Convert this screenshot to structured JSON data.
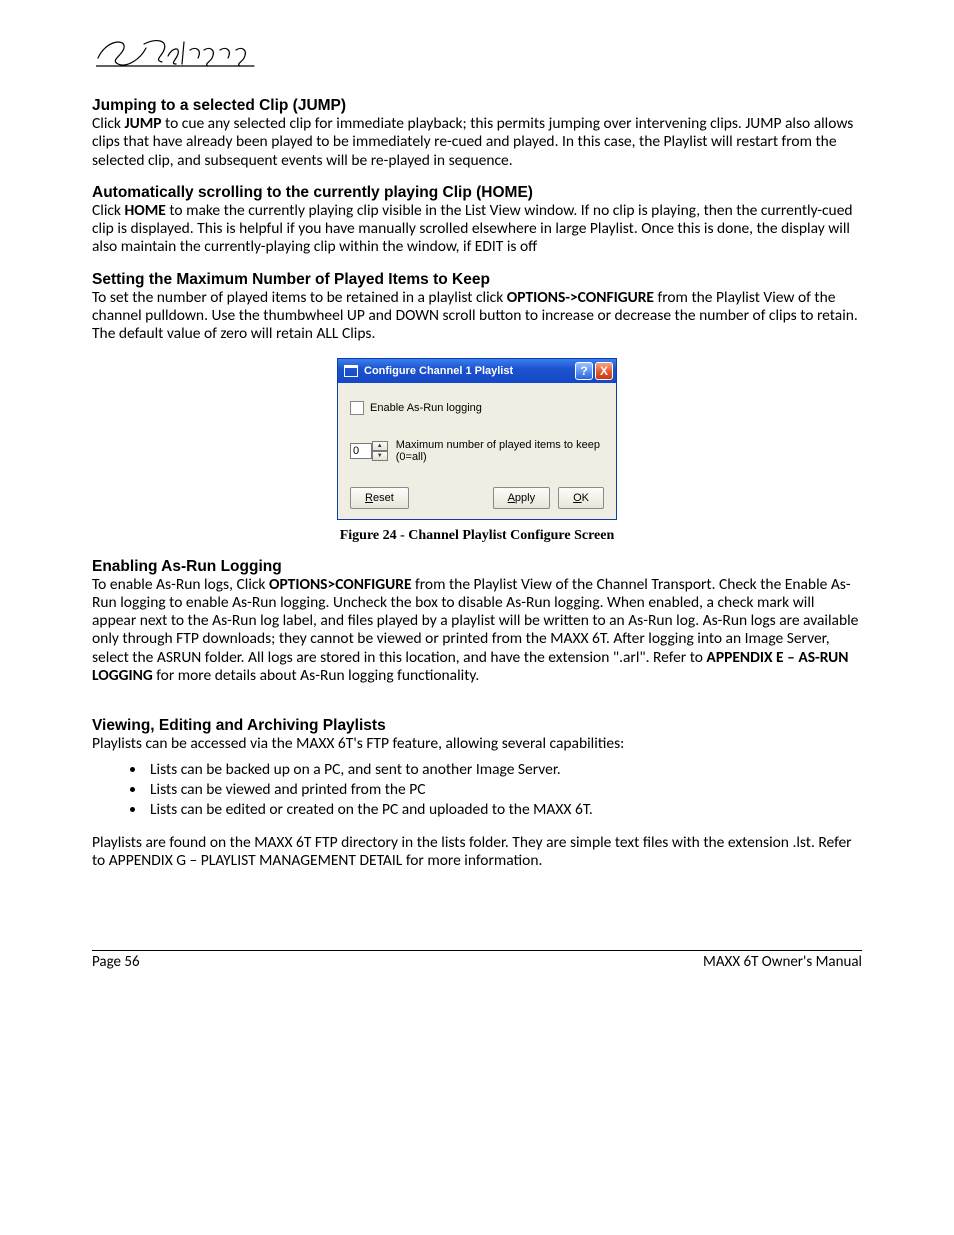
{
  "logo_alt": "360 Systems",
  "sections": {
    "jump": {
      "heading": "Jumping to a selected Clip (JUMP)",
      "p_lead": "Click ",
      "p_bold": "JUMP",
      "p_rest": " to cue any selected clip for immediate playback; this permits jumping over intervening clips.  JUMP also allows clips that have already been played to be immediately re-cued and played.  In this case, the Playlist will restart from the selected clip, and subsequent events will be re-played in sequence."
    },
    "home": {
      "heading": "Automatically scrolling to the currently playing Clip (HOME)",
      "p_lead": "Click ",
      "p_bold": "HOME",
      "p_rest": " to make the currently playing clip visible in the List View window.  If no clip is playing, then the currently-cued clip is displayed. This is helpful if you have manually scrolled elsewhere in large Playlist. Once this is done, the display will also maintain the currently-playing clip within the window, if EDIT is off"
    },
    "keep": {
      "heading": "Setting the Maximum Number of Played Items to Keep",
      "p_lead": "To set the number of played items to be retained in a playlist click ",
      "p_bold": "OPTIONS->CONFIGURE",
      "p_rest": " from the Playlist View of the channel pulldown. Use the thumbwheel UP and DOWN scroll button to increase or decrease the number of clips to retain. The default value of zero will retain ALL Clips."
    },
    "asrun": {
      "heading": "Enabling As-Run Logging",
      "p1_lead": "To enable As-Run logs, Click ",
      "p1_bold": "OPTIONS>CONFIGURE",
      "p1_rest": " from the Playlist View of the Channel Transport. Check the Enable As-Run logging to enable As-Run logging. Uncheck the box to disable As-Run logging.  When enabled, a check mark will appear next to the As-Run log label, and files played by a playlist will be written to an As-Run log. As-Run logs are available only through FTP downloads; they cannot be viewed or printed from the MAXX 6T.  After logging into an Image Server, select the ASRUN folder.  All logs are stored in this location, and have the extension \".arl\". Refer to ",
      "p1_bold2": "APPENDIX E – AS-RUN LOGGING",
      "p1_tail": " for more details about As-Run logging functionality."
    },
    "playlists": {
      "heading": "Viewing, Editing and Archiving Playlists",
      "intro": "Playlists can be accessed via the MAXX 6T's FTP feature, allowing several capabilities:",
      "bullets": [
        "Lists can be backed up on a PC, and sent to another Image Server.",
        "Lists can be viewed and printed from the PC",
        "Lists can be edited or created on the PC and uploaded to the MAXX 6T."
      ],
      "outro": "Playlists are found on the MAXX 6T FTP directory in the lists folder.  They are simple text files with the extension .lst. Refer to APPENDIX G – PLAYLIST MANAGEMENT DETAIL for more information."
    }
  },
  "dialog": {
    "title": "Configure Channel 1 Playlist",
    "help": "?",
    "close": "X",
    "checkbox_label": "Enable As-Run logging",
    "spinner_value": "0",
    "spinner_label": "Maximum number of played items to keep (0=all)",
    "buttons": {
      "reset": "Reset",
      "apply": "Apply",
      "ok": "OK"
    }
  },
  "caption": "Figure 24 - Channel Playlist Configure Screen",
  "footer": {
    "left": "Page 56",
    "right": "MAXX 6T Owner's Manual"
  }
}
